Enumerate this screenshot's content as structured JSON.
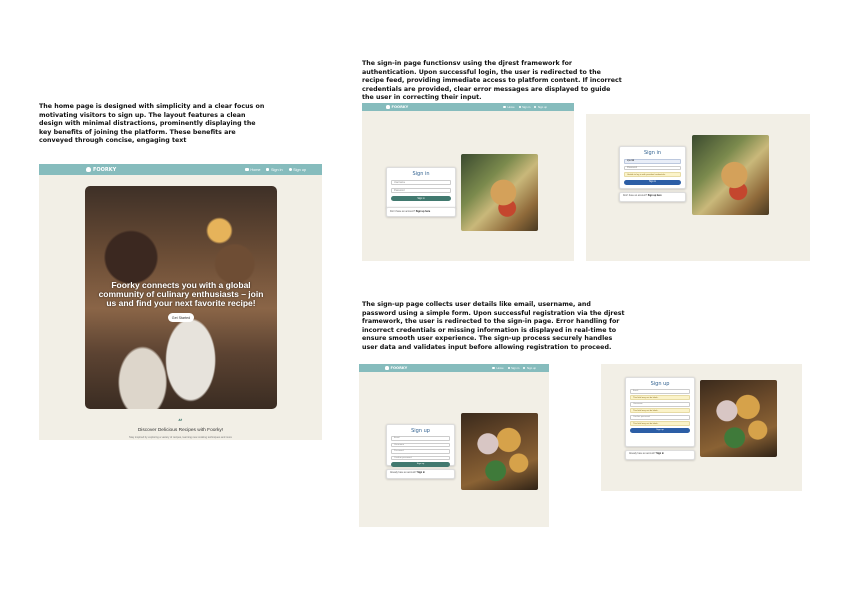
{
  "descriptions": {
    "home": "The home page is designed with simplicity and a clear focus on motivating visitors to sign up. The layout features a clean design with minimal distractions, prominently displaying the key benefits of joining the platform. These benefits are conveyed through concise, engaging text",
    "signin": "The sign-in page functionsv using the djrest framework for authentication. Upon successful login, the user is redirected to the recipe feed, providing immediate access to platform content. If incorrect credentials are provided, clear error messages are displayed to guide the user in correcting their input.",
    "signup": "The sign-up page collects user details like email, username, and password using a simple form. Upon successful registration via the djrest framework, the user is redirected to the sign-in page. Error handling for incorrect credentials or missing information is displayed in real-time to ensure smooth user experience. The sign-up process securely handles user data and validates input before allowing registration to proceed."
  },
  "nav": {
    "brand": "FOORKY",
    "brand_icon": "chef-hat-icon",
    "home": "Home",
    "signin": "Sign in",
    "signup": "Sign up"
  },
  "home": {
    "hero_text": "Foorky connects you with a global community of culinary enthusiasts – join us and find your next favorite recipe!",
    "cta": "Get Started",
    "quote_mark": "“",
    "subheading": "Discover Delicious Recipes with Foorky!",
    "tagline": "Stay inspired by exploring a variety of recipes, learning new cooking techniques and more"
  },
  "signin_form": {
    "title": "Sign in",
    "username_placeholder": "Username",
    "password_placeholder": "Password",
    "button": "Sign in",
    "footer_text": "Don't have an account?",
    "footer_link": "Sign up here"
  },
  "signin_error": {
    "title": "Sign in",
    "username_value": "special",
    "password_placeholder": "Password",
    "error_message": "Unable to log in with provided credentials.",
    "button": "Sign in",
    "footer_text": "Don't have an account?",
    "footer_link": "Sign up here"
  },
  "signup_form": {
    "title": "Sign up",
    "email_placeholder": "Email",
    "username_placeholder": "Username",
    "password_placeholder": "Password",
    "confirm_placeholder": "Confirm password",
    "button": "Sign up",
    "footer_text": "Already have an account?",
    "footer_link": "Sign in"
  },
  "signup_error": {
    "title": "Sign up",
    "email_placeholder": "Email",
    "email_error": "This field may not be blank.",
    "username_placeholder": "Username",
    "username_error": "This field may not be blank.",
    "password_placeholder": "Confirm password",
    "password_error": "This field may not be blank.",
    "button": "Sign up",
    "footer_text": "Already have an account?",
    "footer_link": "Sign in"
  },
  "colors": {
    "nav": "#86bcbd",
    "background": "#f2efe6",
    "primary_button": "#41796f",
    "accent_button": "#2c5ea6",
    "title": "#2e5f8e"
  }
}
